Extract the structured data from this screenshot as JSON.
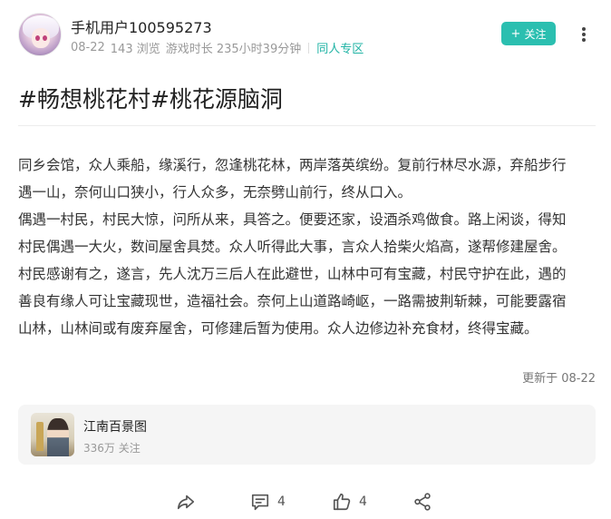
{
  "author": {
    "name": "手机用户100595273",
    "date": "08-22",
    "views": "143 浏览",
    "playtime": "游戏时长 235小时39分钟",
    "zone": "同人专区"
  },
  "actions_top": {
    "follow_label": "关注",
    "follow_icon": "plus-icon",
    "more_icon": "more-vertical-icon"
  },
  "post": {
    "title": "#畅想桃花村#桃花源脑洞",
    "paragraphs": [
      "同乡会馆，众人乘船，缘溪行，忽逢桃花林，两岸落英缤纷。复前行林尽水源，弃船步行",
      "遇一山，奈何山口狭小，行人众多，无奈劈山前行，终从口入。",
      "偶遇一村民，村民大惊，问所从来，具答之。便要还家，设酒杀鸡做食。路上闲谈，得知",
      "村民偶遇一大火，数间屋舍具焚。众人听得此大事，言众人拾柴火焰高，遂帮修建屋舍。",
      "村民感谢有之，遂言，先人沈万三后人在此避世，山林中可有宝藏，村民守护在此，遇的",
      "善良有缘人可让宝藏现世，造福社会。奈何上山道路崎岖，一路需披荆斩棘，可能要露宿",
      "山林，山林间或有废弃屋舍，可修建后暂为使用。众人边修边补充食材，终得宝藏。"
    ],
    "updated": "更新于 08-22"
  },
  "circle": {
    "name": "江南百景图",
    "followers": "336万 关注"
  },
  "bottom_bar": {
    "share_icon": "share-forward-icon",
    "comment_icon": "comment-icon",
    "comment_count": "4",
    "like_icon": "thumbs-up-icon",
    "like_count": "4",
    "network_share_icon": "share-nodes-icon"
  },
  "colors": {
    "accent": "#2bbfb0",
    "zone_text": "#1fb3a4",
    "muted": "#999999"
  }
}
